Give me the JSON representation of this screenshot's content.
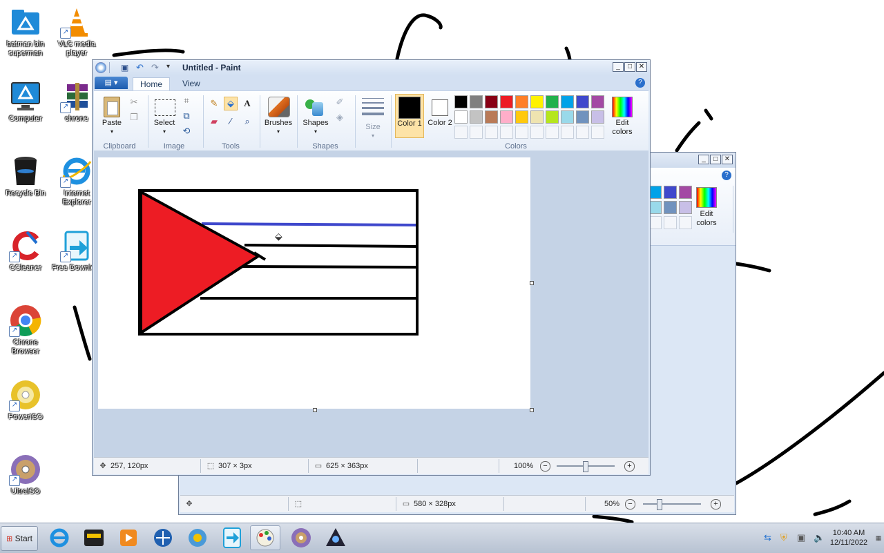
{
  "desktop": {
    "icons": [
      {
        "label": "batman bin superman",
        "icon": "folder-logo-icon"
      },
      {
        "label": "VLC media player",
        "icon": "vlc-cone-icon"
      },
      {
        "label": "Computer",
        "icon": "computer-monitor-icon"
      },
      {
        "label": "chrone",
        "icon": "winrar-books-icon"
      },
      {
        "label": "Recycle Bin",
        "icon": "recycle-bin-icon"
      },
      {
        "label": "Internet Explorer",
        "icon": "internet-explorer-icon"
      },
      {
        "label": "CCleaner",
        "icon": "ccleaner-icon"
      },
      {
        "label": "Free Downlo...",
        "icon": "free-download-icon"
      },
      {
        "label": "Chrone Browser",
        "icon": "chrome-icon"
      },
      {
        "label": "PowerISO",
        "icon": "poweriso-disc-icon"
      },
      {
        "label": "UltraISO",
        "icon": "ultraiso-disc-icon"
      }
    ]
  },
  "paint_back": {
    "edit_colors_label": "Edit colors",
    "status": {
      "canvas_size": "580 × 328px",
      "zoom": "50%"
    },
    "swatches_row1": [
      "#00a2e8",
      "#3f48cc",
      "#a349a4"
    ],
    "swatches_row2": [
      "#99d9ea",
      "#7092be",
      "#c8bfe7"
    ]
  },
  "paint": {
    "title": "Untitled - Paint",
    "file_menu_label": "▤ ▾",
    "tabs": [
      "Home",
      "View"
    ],
    "groups": {
      "clipboard": {
        "label": "Clipboard",
        "paste_label": "Paste"
      },
      "image": {
        "label": "Image",
        "select_label": "Select"
      },
      "tools": {
        "label": "Tools"
      },
      "shapes": {
        "label": "Shapes",
        "brushes_label": "Brushes",
        "shapes_label": "Shapes",
        "size_label": "Size"
      },
      "colors": {
        "label": "Colors",
        "color1_label": "Color 1",
        "color2_label": "Color 2",
        "edit_colors_label": "Edit colors"
      }
    },
    "color1": "#000000",
    "color2": "#ffffff",
    "palette_row1": [
      "#000000",
      "#7f7f7f",
      "#880015",
      "#ed1c24",
      "#ff7f27",
      "#fff200",
      "#22b14c",
      "#00a2e8",
      "#3f48cc",
      "#a349a4"
    ],
    "palette_row2": [
      "#ffffff",
      "#c3c3c3",
      "#b97a57",
      "#ffaec9",
      "#ffc90e",
      "#efe4b0",
      "#b5e61d",
      "#99d9ea",
      "#7092be",
      "#c8bfe7"
    ],
    "status": {
      "cursor_pos": "257, 120px",
      "selection_size": "307 × 3px",
      "canvas_size": "625 × 363px",
      "zoom": "100%"
    },
    "drawing": {
      "triangle_color": "#ed1c24",
      "line_color": "#3f48cc",
      "stroke_color": "#000000"
    }
  },
  "taskbar": {
    "start_label": "Start",
    "apps": [
      {
        "icon": "internet-explorer-icon"
      },
      {
        "icon": "media-app-icon"
      },
      {
        "icon": "media-player-icon"
      },
      {
        "icon": "satellite-app-icon"
      },
      {
        "icon": "ccleaner-icon"
      },
      {
        "icon": "free-download-icon"
      },
      {
        "icon": "paint-icon"
      },
      {
        "icon": "disc-icon"
      },
      {
        "icon": "game-app-icon"
      }
    ],
    "clock_time": "10:40 AM",
    "clock_date": "12/11/2022"
  }
}
